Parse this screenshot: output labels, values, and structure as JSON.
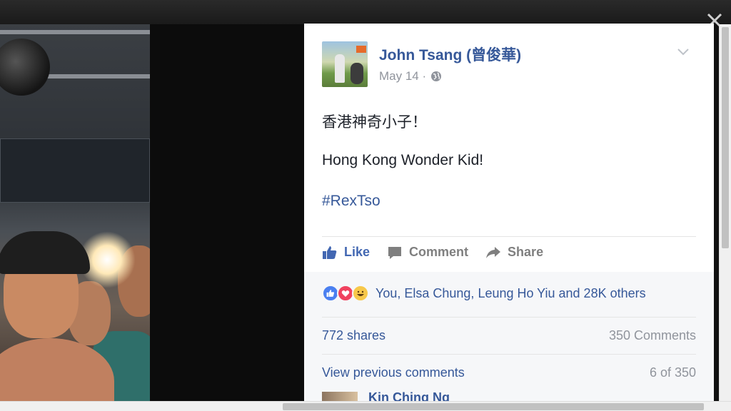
{
  "post": {
    "author": "John Tsang (曾俊華)",
    "date": "May 14 ·",
    "text_chinese": "香港神奇小子！",
    "text_english": "Hong Kong Wonder Kid!",
    "hashtag": "#RexTso"
  },
  "actions": {
    "like": "Like",
    "comment": "Comment",
    "share": "Share"
  },
  "reactions": {
    "summary": "You, Elsa Chung, Leung Ho Yiu and 28K others",
    "icons": [
      "like-icon",
      "love-icon",
      "haha-icon"
    ]
  },
  "stats": {
    "shares": "772 shares",
    "comments": "350 Comments"
  },
  "comments": {
    "view_previous": "View previous comments",
    "page_count": "6 of 350",
    "first_commenter": "Kin Ching Ng"
  },
  "colors": {
    "link": "#365899",
    "like_blue": "#4267b2",
    "muted": "#90949c"
  }
}
